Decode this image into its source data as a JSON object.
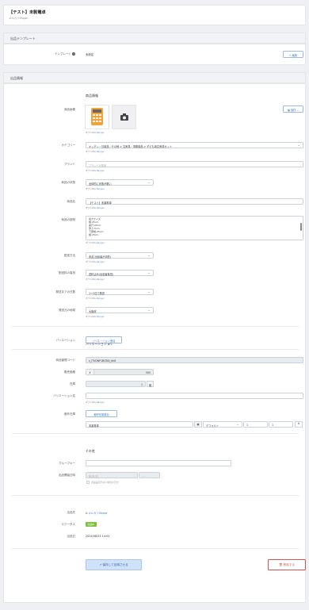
{
  "header": {
    "title": "【テスト】未製電卓",
    "subtitle": "メルカリShops"
  },
  "template_section": {
    "heading": "出品テンプレート",
    "label": "テンプレート",
    "value": "未設定",
    "edit_label": "編集"
  },
  "listing_section": {
    "heading": "出品情報",
    "product_info_title": "商品情報",
    "operation_label": "操作",
    "sub_prefix": "ギフトIDs",
    "sub_link": "Ranger",
    "image_label": "商品画像",
    "category_label": "カテゴリー",
    "category_value": "キッチン・日用品・その他 > 文房具・事務用品 > 子ども用文房具セット",
    "brand_label": "ブランド",
    "brand_placeholder": "ブランドを検索",
    "condition_label": "商品の状態",
    "condition_value": "全体的に状態が悪い",
    "name_label": "商品名",
    "name_value": "【テスト】未製電卓",
    "desc_label": "商品の説明",
    "desc_lines": [
      "",
      "最大サイズ",
      "幅:25cm",
      "奥行:25cm",
      "厚さ:5cm",
      "下部幅:25cm",
      "幅:25cm"
    ],
    "shipping_method_label": "配送方法",
    "shipping_method_value": "未定(出品者が手配)",
    "shipping_fee_label": "配送料の負担",
    "shipping_fee_value": "送料込み(出品者負担)",
    "days_label": "発送までの日数",
    "days_value": "1〜2日で発送",
    "origin_label": "発送元の地域",
    "origin_value": "大阪府"
  },
  "variation": {
    "label": "バリエーション",
    "add_label": "バリエーション追加",
    "title": "バリエーション #1",
    "code_label": "商品管理コード",
    "code_value": "s_ITVDNP1BCB0l_dh8",
    "price_label": "販売価格",
    "price_prefix": "¥",
    "price_value": "500",
    "stock_label": "在庫",
    "stock_value": "1",
    "stock_unit": "個",
    "var_name_label": "バリエーション名",
    "warehouse_label": "都外在庫",
    "warehouse_add": "都外在庫追加",
    "row_name": "本製電卓",
    "row_type": "デフォルト",
    "row_qty1": "1",
    "row_qty2": "1"
  },
  "other": {
    "title": "その他",
    "group_label": "グループキー",
    "start_label": "出品開始日時",
    "date_placeholder": "年/月/日",
    "time_placeholder": "--:--",
    "check_label": "出品設定がない場合の日付"
  },
  "meta": {
    "site_label": "出品先",
    "site_value": "メルカリShops",
    "status_label": "ステータス",
    "status_value": "出品中",
    "date_label": "出品日",
    "date_value": "2024/08/23 14:03"
  },
  "actions": {
    "save_label": "保存して反映させる",
    "delete_label": "削除する"
  },
  "colors": {
    "accent": "#3d74c5",
    "status": "#7dbf3f",
    "danger": "#d9534f",
    "save_bg": "#cfe2f7"
  }
}
